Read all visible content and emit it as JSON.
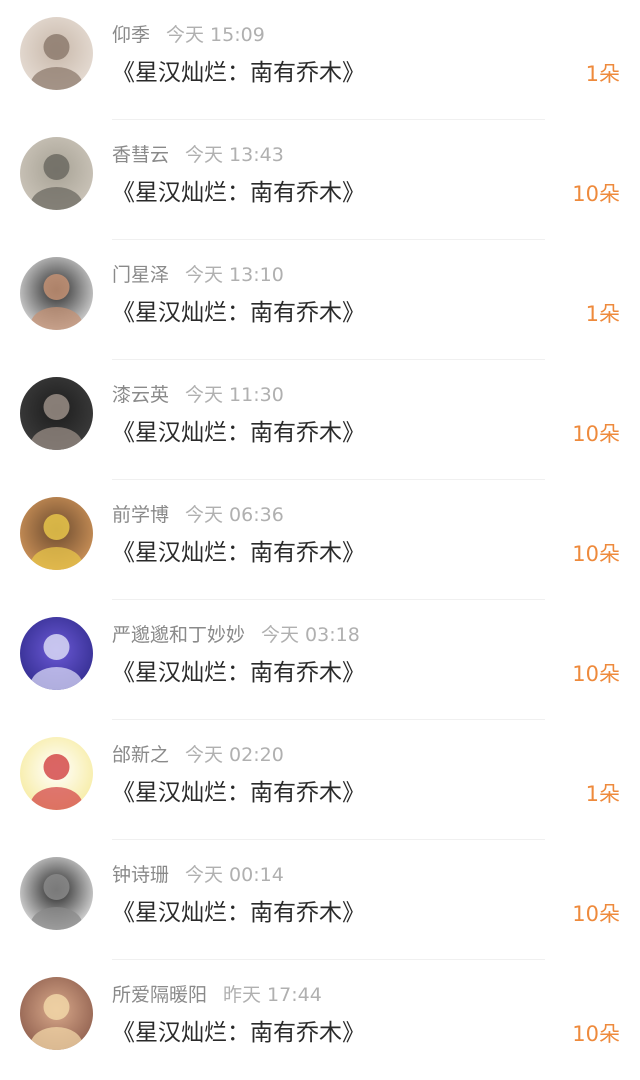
{
  "gifts": [
    {
      "name": "仰季",
      "time": "今天 15:09",
      "title": "《星汉灿烂：南有乔木》",
      "count": "1朵",
      "avatar_colors": [
        "#e9e0d8",
        "#c8b8aa",
        "#8d7b6e"
      ]
    },
    {
      "name": "香彗云",
      "time": "今天 13:43",
      "title": "《星汉灿烂：南有乔木》",
      "count": "10朵",
      "avatar_colors": [
        "#cfc8bd",
        "#a7a295",
        "#6c6a62"
      ]
    },
    {
      "name": "门星泽",
      "time": "今天 13:10",
      "title": "《星汉灿烂：南有乔木》",
      "count": "1朵",
      "avatar_colors": [
        "#e7e7e7",
        "#2a2a2a",
        "#c49274"
      ]
    },
    {
      "name": "漆云英",
      "time": "今天 11:30",
      "title": "《星汉灿烂：南有乔木》",
      "count": "10朵",
      "avatar_colors": [
        "#3f3f3f",
        "#1c1c1c",
        "#9a8e86"
      ]
    },
    {
      "name": "前学博",
      "time": "今天 06:36",
      "title": "《星汉灿烂：南有乔木》",
      "count": "10朵",
      "avatar_colors": [
        "#d79a5d",
        "#6b4a2e",
        "#e8c54a"
      ]
    },
    {
      "name": "严邈邈和丁妙妙",
      "time": "今天 03:18",
      "title": "《星汉灿烂：南有乔木》",
      "count": "10朵",
      "avatar_colors": [
        "#2f2a8a",
        "#6b59d6",
        "#d8d8f5"
      ]
    },
    {
      "name": "邰新之",
      "time": "今天 02:20",
      "title": "《星汉灿烂：南有乔木》",
      "count": "1朵",
      "avatar_colors": [
        "#f6ea9a",
        "#ffffff",
        "#d44a4a"
      ]
    },
    {
      "name": "钟诗珊",
      "time": "今天 00:14",
      "title": "《星汉灿烂：南有乔木》",
      "count": "10朵",
      "avatar_colors": [
        "#f0f0f0",
        "#222222",
        "#8a8a8a"
      ]
    },
    {
      "name": "所爱隔暖阳",
      "time": "昨天 17:44",
      "title": "《星汉灿烂：南有乔木》",
      "count": "10朵",
      "avatar_colors": [
        "#8a5a4a",
        "#d9a98b",
        "#f1d6a7"
      ]
    }
  ]
}
